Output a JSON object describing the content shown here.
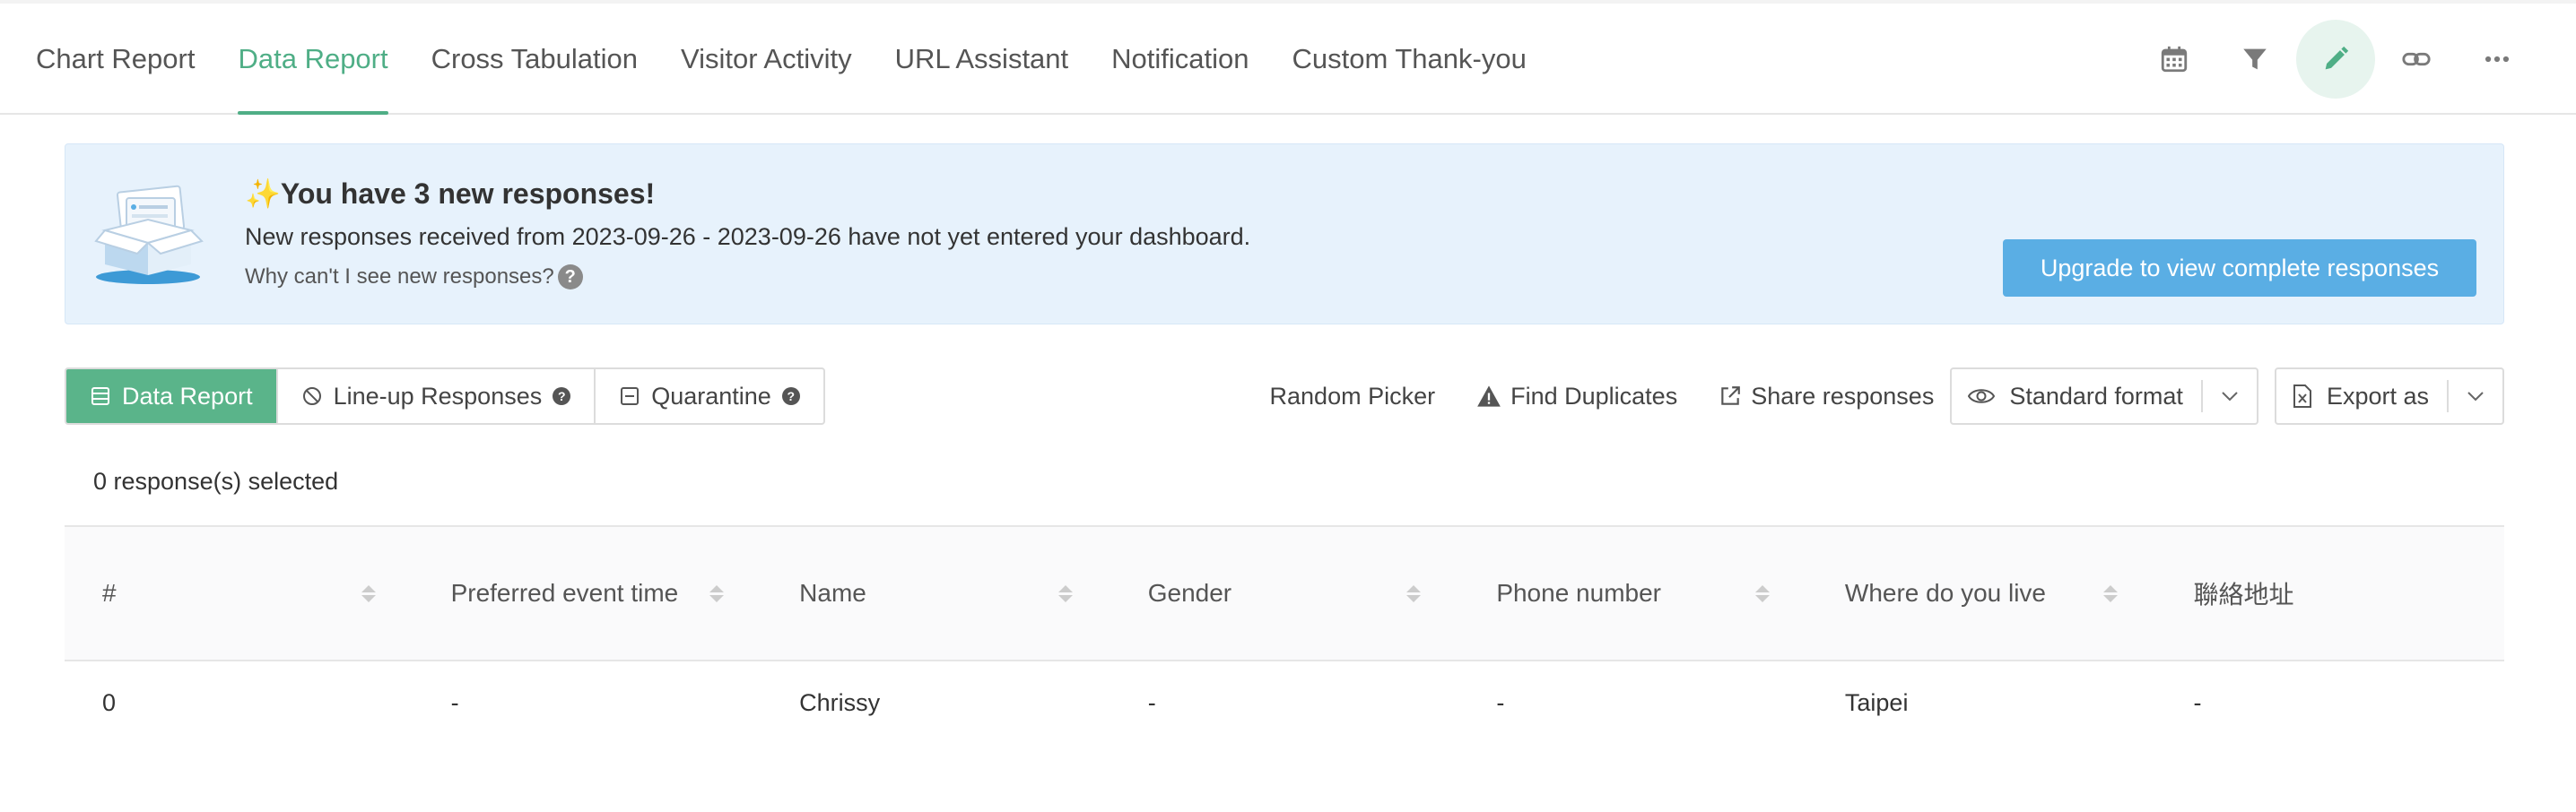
{
  "nav": {
    "tabs": [
      {
        "label": "Chart Report"
      },
      {
        "label": "Data Report"
      },
      {
        "label": "Cross Tabulation"
      },
      {
        "label": "Visitor Activity"
      },
      {
        "label": "URL Assistant"
      },
      {
        "label": "Notification"
      },
      {
        "label": "Custom Thank-you"
      }
    ],
    "active_tab": "Data Report",
    "icons": [
      "calendar-icon",
      "filter-icon",
      "pencil-icon",
      "link-icon",
      "more-icon"
    ]
  },
  "banner": {
    "title": "✨You have 3 new responses!",
    "description": "New responses received from 2023-09-26 - 2023-09-26 have not yet entered your dashboard.",
    "help_text": "Why can't I see new responses?",
    "help_mark": "?",
    "upgrade_label": "Upgrade to view complete responses"
  },
  "toolbar": {
    "views": [
      {
        "label": "Data Report"
      },
      {
        "label": "Line-up Responses"
      },
      {
        "label": "Quarantine"
      }
    ],
    "random_picker": "Random Picker",
    "find_duplicates": "Find Duplicates",
    "share_responses": "Share responses",
    "format_label": "Standard format",
    "export_label": "Export as"
  },
  "selection": {
    "text": "0 response(s) selected"
  },
  "table": {
    "columns": [
      "#",
      "Preferred event time",
      "Name",
      "Gender",
      "Phone number",
      "Where do you live",
      "聯絡地址"
    ],
    "rows": [
      [
        "0",
        "-",
        "Chrissy",
        "-",
        "-",
        "Taipei",
        "-"
      ]
    ]
  },
  "colors": {
    "accent": "#4fae86",
    "active_segment": "#5ab48a",
    "banner_bg": "#e7f2fc",
    "upgrade_button": "#5aaee4"
  }
}
